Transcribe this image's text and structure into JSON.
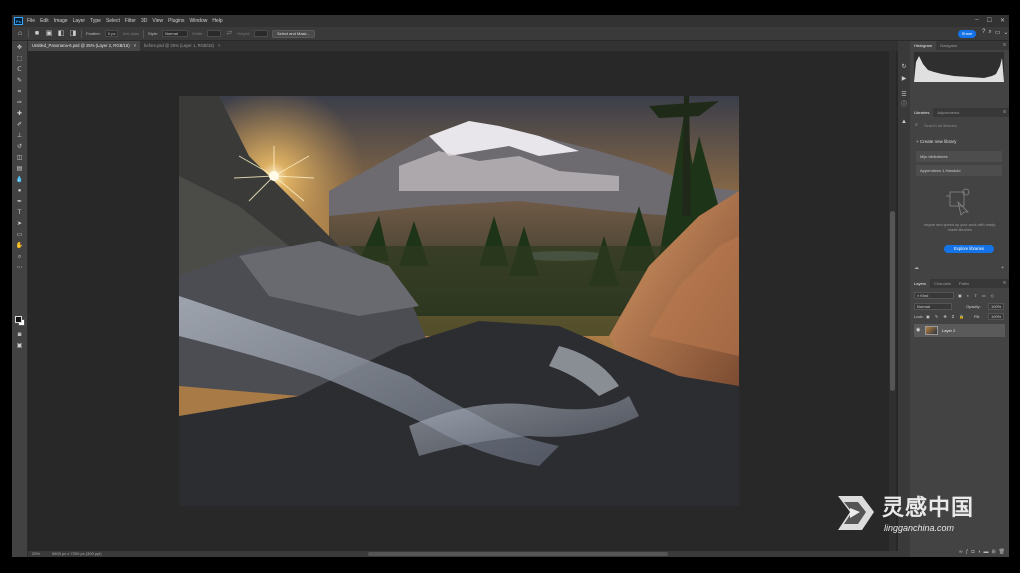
{
  "app": {
    "logo": "Ps"
  },
  "menu": [
    "File",
    "Edit",
    "Image",
    "Layer",
    "Type",
    "Select",
    "Filter",
    "3D",
    "View",
    "Plugins",
    "Window",
    "Help"
  ],
  "window_controls": [
    "–",
    "☐",
    "✕"
  ],
  "options": {
    "feather_label": "Feather:",
    "feather_value": "0 px",
    "antialias_label": "Anti-alias",
    "style_label": "Style:",
    "style_value": "Normal",
    "width_label": "Width:",
    "height_label": "Height:",
    "select_mask_label": "Select and Mask...",
    "share_label": "Share"
  },
  "tabs": [
    {
      "label": "Untitled_Panorama-6.psd @ 25% (Layer 2, RGB/16)",
      "close": "×"
    },
    {
      "label": "before.psd @ 25% (Layer 1, RGB/16)",
      "close": "×"
    }
  ],
  "status": {
    "zoom": "25%",
    "doc": "9600 px x 7200 px (300 ppi)"
  },
  "panels": {
    "histogram_tabs": [
      "Histogram",
      "Navigator"
    ],
    "libraries_tabs": [
      "Libraries",
      "Adjustments"
    ],
    "library_search_placeholder": "Search all libraries",
    "create_library": "Create new library",
    "library_items": [
      "Mijn bibliotheek",
      "Appendices 1-Handold"
    ],
    "library_desc": "Inspire and speed up your work with ready-made libraries",
    "explore_button": "Explore libraries",
    "layers_tabs": [
      "Layers",
      "Channels",
      "Paths"
    ],
    "kind_label": "Kind",
    "blend_mode": "Normal",
    "opacity_label": "Opacity:",
    "opacity_value": "100%",
    "lock_label": "Lock:",
    "fill_label": "Fill:",
    "fill_value": "100%",
    "layer_name": "Layer 2"
  },
  "watermark": {
    "cn": "灵感中国",
    "en": "lingganchina.com"
  },
  "colors": {
    "accent": "#1473e6",
    "panel": "#434343",
    "canvas": "#282828"
  }
}
